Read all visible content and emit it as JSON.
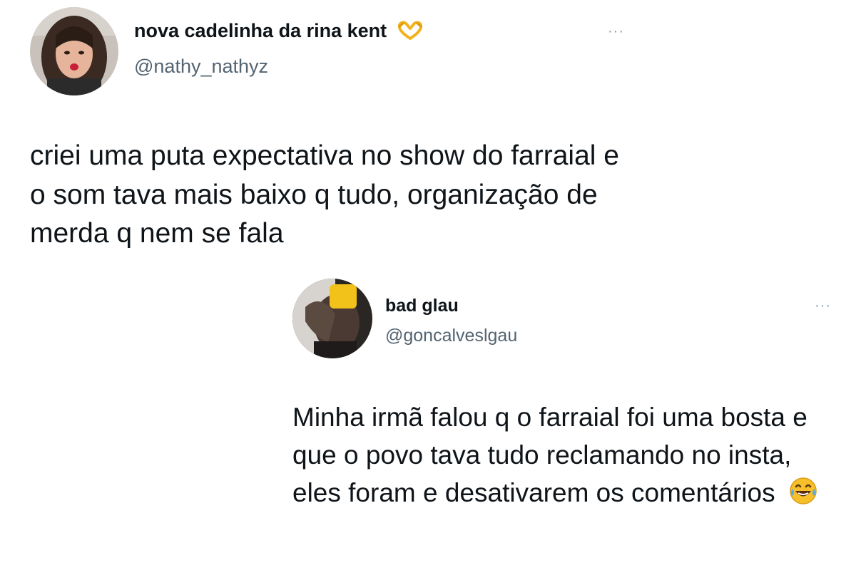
{
  "tweets": [
    {
      "name": "nova cadelinha da rina kent",
      "name_icon": "heart-hands-icon",
      "handle": "@nathy_nathyz",
      "more_label": "···",
      "text": "criei uma puta expectativa no show do farraial e o som tava mais baixo q tudo, organização de merda q nem se fala"
    },
    {
      "name": "bad glau",
      "handle": "@goncalveslgau",
      "more_label": "···",
      "text": "Minha irmã falou q o farraial foi uma bosta e que o povo tava tudo reclamando no insta, eles foram e desativarem os comentários",
      "text_icon": "laughing-tears-emoji-icon"
    }
  ],
  "colors": {
    "text": "#0f1419",
    "handle": "#536471",
    "more": "#8899a6",
    "emoji": "#f7c02b"
  }
}
